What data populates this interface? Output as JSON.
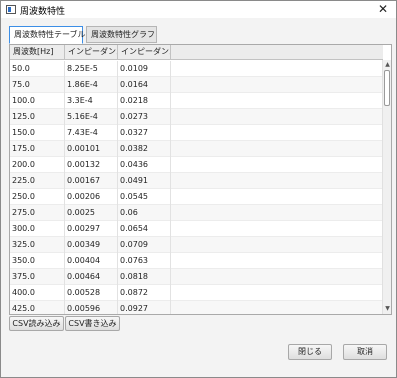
{
  "window": {
    "title": "周波数特性"
  },
  "titlebar": {
    "close_glyph": "✕"
  },
  "tabs": [
    {
      "label": "周波数特性テーブル",
      "active": true
    },
    {
      "label": "周波数特性グラフ",
      "active": false
    }
  ],
  "table": {
    "headers": [
      "周波数[Hz]",
      "インピーダンス…",
      "インピーダンス…"
    ],
    "rows": [
      [
        "50.0",
        "8.25E-5",
        "0.0109"
      ],
      [
        "75.0",
        "1.86E-4",
        "0.0164"
      ],
      [
        "100.0",
        "3.3E-4",
        "0.0218"
      ],
      [
        "125.0",
        "5.16E-4",
        "0.0273"
      ],
      [
        "150.0",
        "7.43E-4",
        "0.0327"
      ],
      [
        "175.0",
        "0.00101",
        "0.0382"
      ],
      [
        "200.0",
        "0.00132",
        "0.0436"
      ],
      [
        "225.0",
        "0.00167",
        "0.0491"
      ],
      [
        "250.0",
        "0.00206",
        "0.0545"
      ],
      [
        "275.0",
        "0.0025",
        "0.06"
      ],
      [
        "300.0",
        "0.00297",
        "0.0654"
      ],
      [
        "325.0",
        "0.00349",
        "0.0709"
      ],
      [
        "350.0",
        "0.00404",
        "0.0763"
      ],
      [
        "375.0",
        "0.00464",
        "0.0818"
      ],
      [
        "400.0",
        "0.00528",
        "0.0872"
      ],
      [
        "425.0",
        "0.00596",
        "0.0927"
      ]
    ]
  },
  "buttons": {
    "csv_load": "CSV読み込み",
    "csv_write": "CSV書き込み",
    "close": "閉じる",
    "cancel": "取消"
  }
}
